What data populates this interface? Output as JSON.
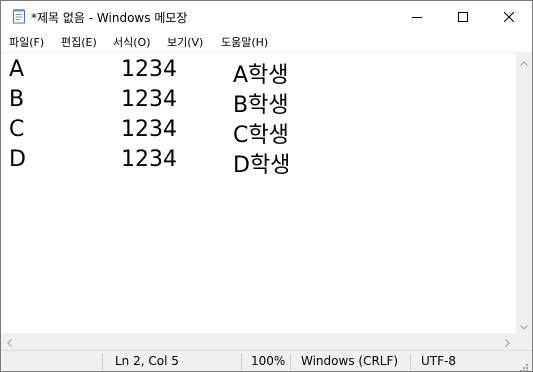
{
  "window": {
    "title": "*제목 없음 - Windows 메모장"
  },
  "menu": [
    {
      "label": "파일(F)"
    },
    {
      "label": "편집(E)"
    },
    {
      "label": "서식(O)"
    },
    {
      "label": "보기(V)"
    },
    {
      "label": "도움말(H)"
    }
  ],
  "editor": {
    "lines": [
      {
        "c1": "A",
        "c2": "1234",
        "c3": "A학생"
      },
      {
        "c1": "B",
        "c2": "1234",
        "c3": "B학생"
      },
      {
        "c1": "C",
        "c2": "1234",
        "c3": "C학생"
      },
      {
        "c1": "D",
        "c2": "1234",
        "c3": "D학생"
      }
    ]
  },
  "status": {
    "position": "Ln 2, Col 5",
    "zoom": "100%",
    "line_ending": "Windows (CRLF)",
    "encoding": "UTF-8"
  },
  "icons": {
    "app": "notepad-icon",
    "minimize": "minimize-icon",
    "maximize": "maximize-icon",
    "close": "close-icon"
  }
}
